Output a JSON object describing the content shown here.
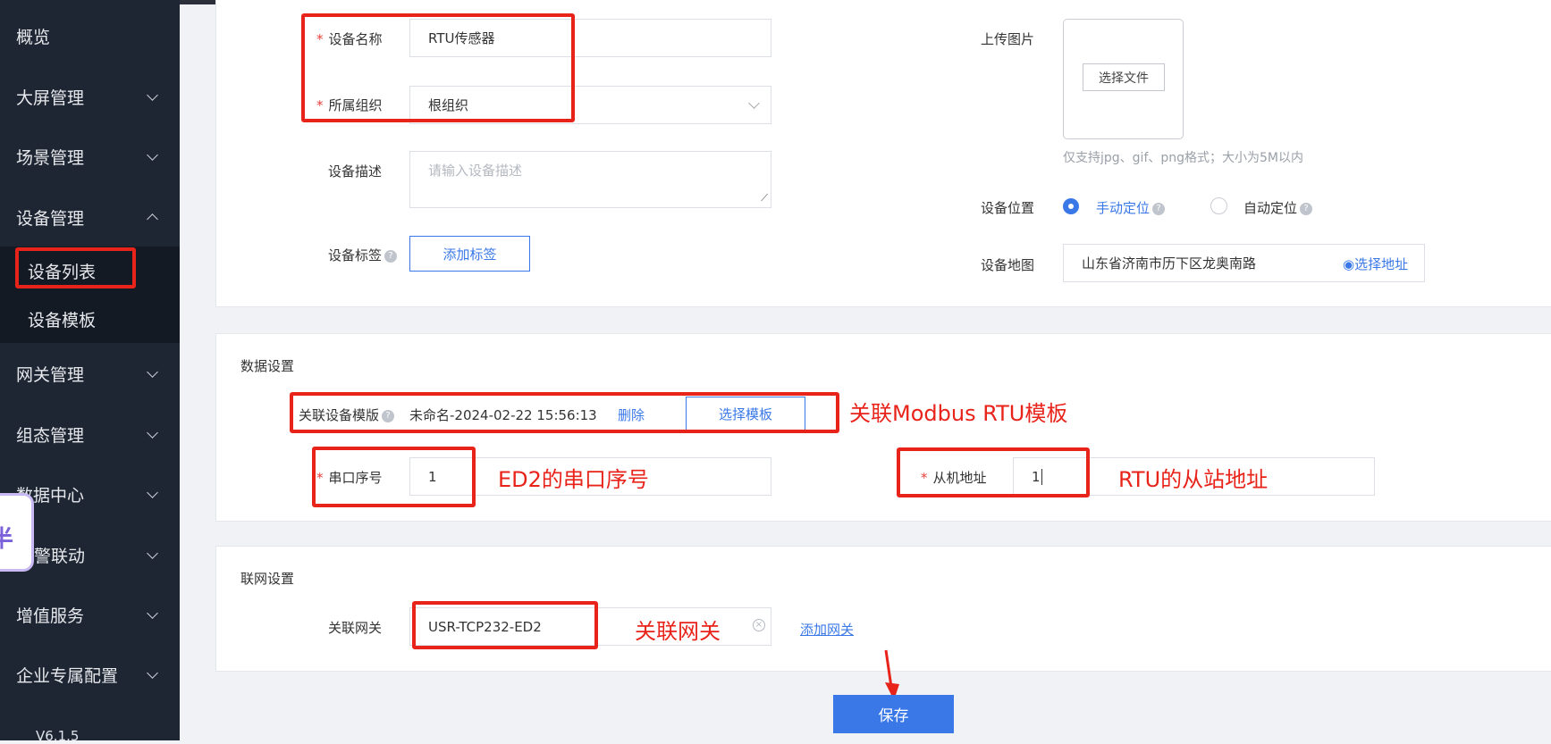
{
  "sidebar": {
    "items": [
      {
        "label": "概览"
      },
      {
        "label": "大屏管理"
      },
      {
        "label": "场景管理"
      },
      {
        "label": "设备管理"
      },
      {
        "label": "网关管理"
      },
      {
        "label": "组态管理"
      },
      {
        "label": "数据中心"
      },
      {
        "label": "警联动"
      },
      {
        "label": "增值服务"
      },
      {
        "label": "企业专属配置"
      }
    ],
    "submenu": [
      {
        "label": "设备列表"
      },
      {
        "label": "设备模板"
      }
    ],
    "version": "V6.1.5",
    "float_badge": "半"
  },
  "basic": {
    "device_name_label": "设备名称",
    "device_name_value": "RTU传感器",
    "org_label": "所属组织",
    "org_value": "根组织",
    "desc_label": "设备描述",
    "desc_placeholder": "请输入设备描述",
    "tag_label": "设备标签",
    "tag_button": "添加标签",
    "upload_label": "上传图片",
    "upload_button": "选择文件",
    "upload_hint": "仅支持jpg、gif、png格式；大小为5M以内",
    "location_label": "设备位置",
    "manual_location": "手动定位",
    "auto_location": "自动定位",
    "map_label": "设备地图",
    "map_value": "山东省济南市历下区龙奥南路",
    "map_select": "选择地址"
  },
  "data_settings": {
    "section_title": "数据设置",
    "template_label": "关联设备模版",
    "template_value": "未命名-2024-02-22 15:56:13",
    "delete_link": "删除",
    "select_template": "选择模板",
    "serial_label": "串口序号",
    "serial_value": "1",
    "slave_label": "从机地址",
    "slave_value": "1"
  },
  "network": {
    "section_title": "联网设置",
    "gateway_label": "关联网关",
    "gateway_value": "USR-TCP232-ED2",
    "add_gateway": "添加网关"
  },
  "annotations": {
    "template_note": "关联Modbus RTU模板",
    "serial_note": "ED2的串口序号",
    "slave_note": "RTU的从站地址",
    "gateway_note": "关联网关"
  },
  "save_button": "保存",
  "colors": {
    "accent": "#3a78e7",
    "annotation": "#e8231a",
    "sidebar_bg": "#1f2633"
  }
}
